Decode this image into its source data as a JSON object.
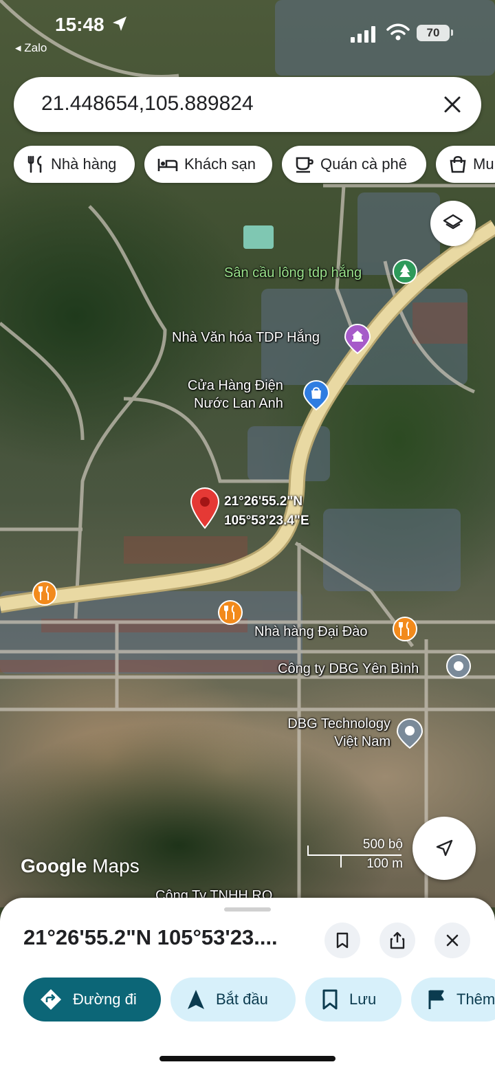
{
  "status_bar": {
    "time": "15:48",
    "back_app": "◂ Zalo",
    "battery": "70"
  },
  "search": {
    "value": "21.448654,105.889824"
  },
  "chips": [
    {
      "label": "Nhà hàng",
      "icon": "restaurant-icon"
    },
    {
      "label": "Khách sạn",
      "icon": "hotel-icon"
    },
    {
      "label": "Quán cà phê",
      "icon": "coffee-icon"
    },
    {
      "label": "Mu",
      "icon": "shopping-bag-icon"
    }
  ],
  "map": {
    "pin_label": {
      "lat": "21°26'55.2\"N",
      "lng": "105°53'23.4\"E"
    },
    "pois": [
      {
        "name": "Sân cầu lông tdp hắng",
        "icon": "park-icon",
        "color": "#2e9a5a"
      },
      {
        "name_line1": "Nhà Văn hóa TDP Hắng",
        "icon": "landmark-icon",
        "color": "#a65bc9"
      },
      {
        "name_line1": "Cửa Hàng Điện",
        "name_line2": "Nước Lan Anh",
        "icon": "store-icon",
        "color": "#2f7de1"
      },
      {
        "name": "Nhà hàng Đại Đào",
        "icon": "restaurant-icon",
        "color": "#f28a1c"
      },
      {
        "name": "Công ty DBG Yên Bình",
        "icon": "place-icon",
        "color": "#7a8a99"
      },
      {
        "name_line1": "DBG Technology",
        "name_line2": "Việt Nam",
        "icon": "place-icon",
        "color": "#7a8a99"
      },
      {
        "name": "Công Ty TNHH RO",
        "icon": "place-icon",
        "color": "#7a8a99"
      }
    ],
    "logo": {
      "google": "Google",
      "maps": "Maps"
    },
    "scale": {
      "imperial": "500 bộ",
      "metric": "100 m"
    },
    "road_color": "#e9d9a3",
    "pin_color": "#e53935"
  },
  "sheet": {
    "title": "21°26'55.2\"N 105°53'23....",
    "actions": [
      {
        "label": "Đường đi",
        "icon": "directions-icon"
      },
      {
        "label": "Bắt đầu",
        "icon": "navigation-icon"
      },
      {
        "label": "Lưu",
        "icon": "bookmark-icon"
      },
      {
        "label": "Thêm",
        "icon": "flag-icon"
      }
    ]
  }
}
